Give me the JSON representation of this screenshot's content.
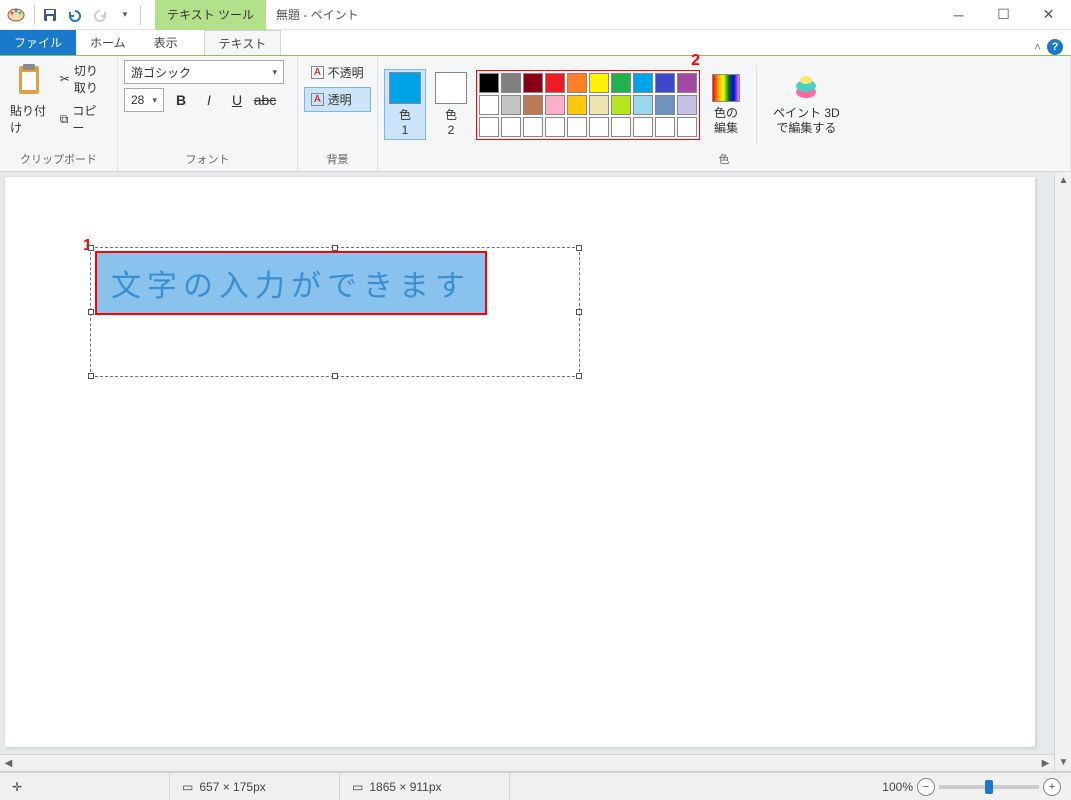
{
  "title": {
    "app_name": "無題 - ペイント",
    "context_tool": "テキスト ツール"
  },
  "tabs": {
    "file": "ファイル",
    "home": "ホーム",
    "view": "表示",
    "text": "テキスト"
  },
  "clipboard": {
    "paste": "貼り付け",
    "cut": "切り取り",
    "copy": "コピー",
    "label": "クリップボード"
  },
  "font": {
    "name": "游ゴシック",
    "size": "28",
    "label": "フォント"
  },
  "background": {
    "opaque": "不透明",
    "transparent": "透明",
    "label": "背景"
  },
  "colors": {
    "color1": "色\n1",
    "color1_hex": "#00a2e8",
    "color2": "色\n2",
    "color2_hex": "#ffffff",
    "edit": "色の\n編集",
    "label": "色",
    "row1": [
      "#000000",
      "#7f7f7f",
      "#880015",
      "#ed1c24",
      "#ff7f27",
      "#fff200",
      "#22b14c",
      "#00a2e8",
      "#3f48cc",
      "#a349a4"
    ],
    "row2": [
      "#ffffff",
      "#c3c3c3",
      "#b97a57",
      "#ffaec9",
      "#ffc90e",
      "#efe4b0",
      "#b5e61d",
      "#99d9ea",
      "#7092be",
      "#c8bfe7"
    ],
    "row3": [
      "#ffffff",
      "#ffffff",
      "#ffffff",
      "#ffffff",
      "#ffffff",
      "#ffffff",
      "#ffffff",
      "#ffffff",
      "#ffffff",
      "#ffffff"
    ]
  },
  "paint3d": "ペイント 3D\nで編集する",
  "canvas": {
    "text": "文字の入力ができます"
  },
  "annotations": {
    "one": "1",
    "two": "2"
  },
  "status": {
    "selection_size": "657 × 175px",
    "canvas_size": "1865 × 911px",
    "zoom": "100%"
  }
}
